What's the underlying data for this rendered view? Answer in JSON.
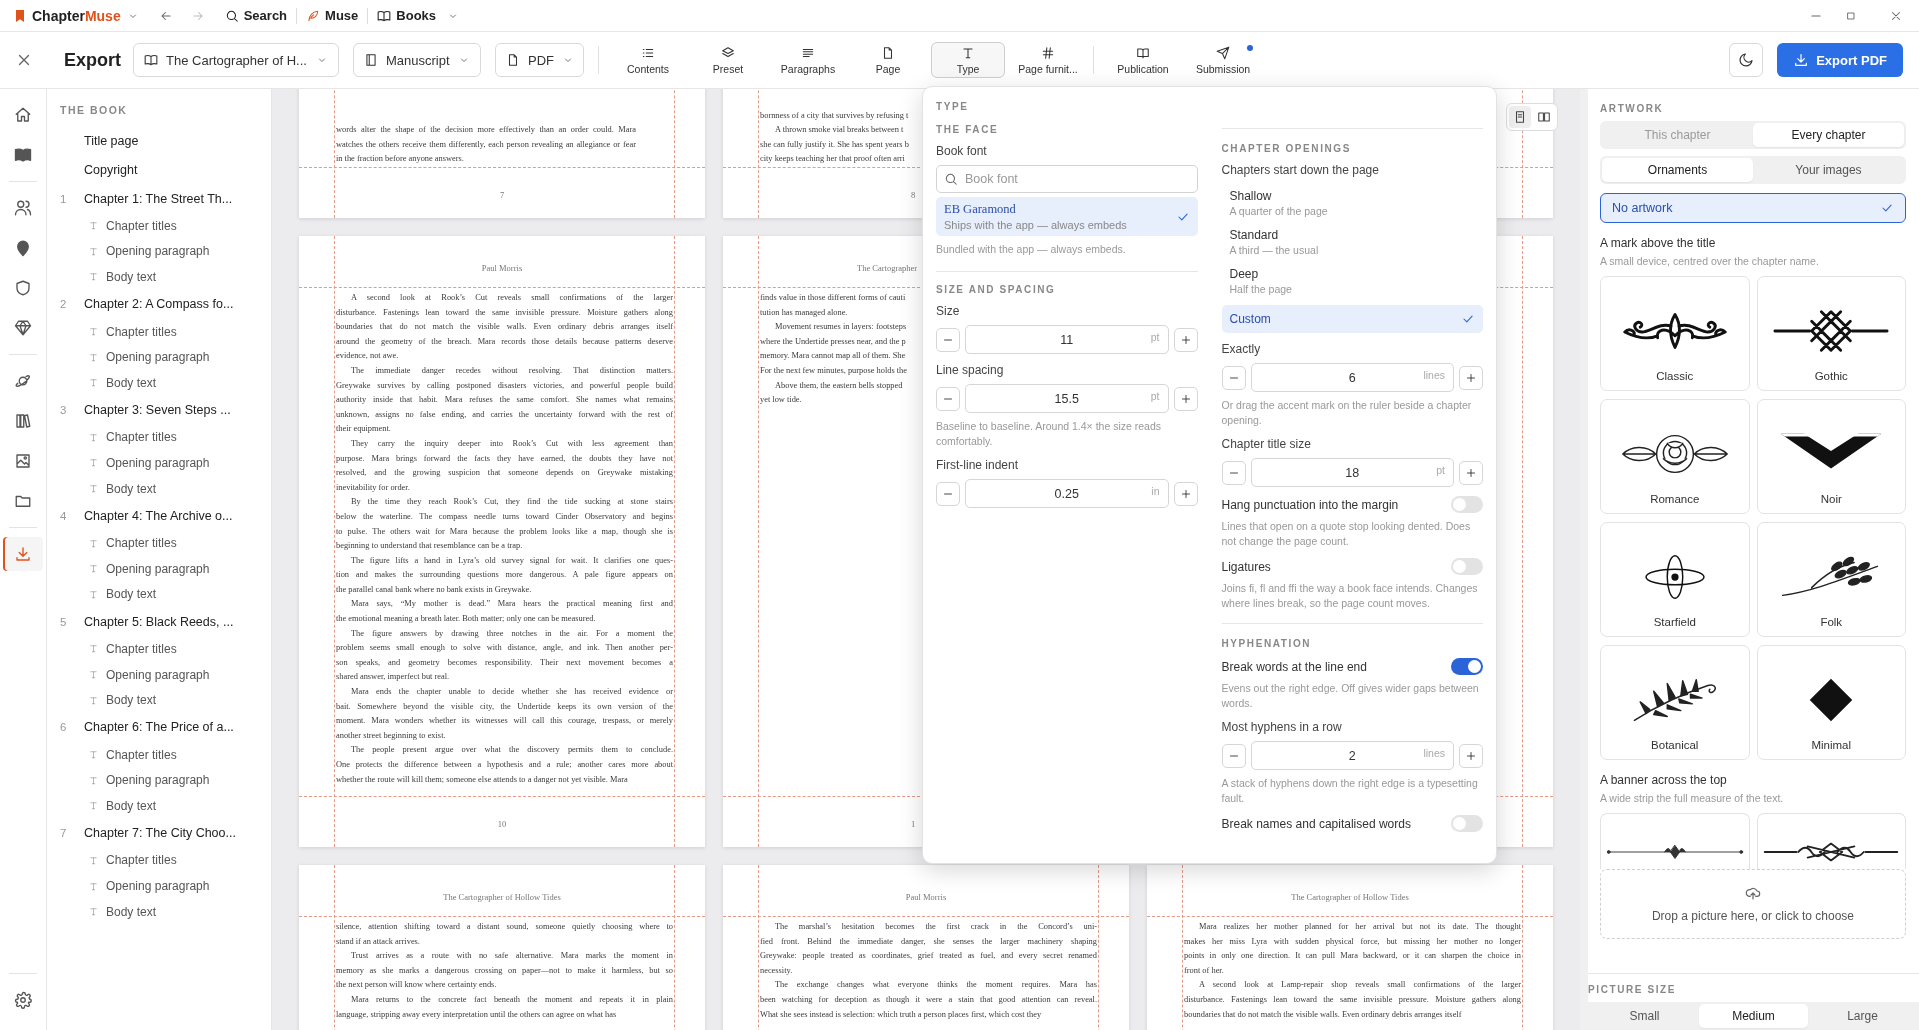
{
  "titlebar": {
    "brand_first": "Chapter",
    "brand_second": "Muse",
    "nav": [
      {
        "kind": "search",
        "label": "Search"
      },
      {
        "kind": "quill",
        "label": "Muse"
      },
      {
        "kind": "book",
        "label": "Books"
      }
    ]
  },
  "toolbar": {
    "title": "Export",
    "dropdowns": [
      {
        "kind": "book",
        "label": "The Cartographer of H..."
      },
      {
        "kind": "manuscript",
        "label": "Manuscript"
      },
      {
        "kind": "file",
        "label": "PDF"
      }
    ],
    "tool_groups": [
      [
        {
          "kind": "list",
          "label": "Contents",
          "selected": false,
          "dot": false
        },
        {
          "kind": "layers",
          "label": "Preset",
          "selected": false,
          "dot": false
        },
        {
          "kind": "paragraphs",
          "label": "Paragraphs",
          "selected": false,
          "dot": false
        },
        {
          "kind": "page",
          "label": "Page",
          "selected": false,
          "dot": false
        },
        {
          "kind": "type",
          "label": "Type",
          "selected": true,
          "dot": false
        },
        {
          "kind": "hash",
          "label": "Page furnit...",
          "selected": false,
          "dot": false
        }
      ],
      [
        {
          "kind": "open-book",
          "label": "Publication",
          "selected": false,
          "dot": false
        },
        {
          "kind": "send",
          "label": "Submission",
          "selected": false,
          "dot": true
        }
      ]
    ],
    "export_label": "Export PDF"
  },
  "rail": [
    [
      {
        "kind": "home",
        "selected": false
      },
      {
        "kind": "book",
        "selected": false
      }
    ],
    [
      {
        "kind": "users",
        "selected": false
      },
      {
        "kind": "map-pin",
        "selected": false
      },
      {
        "kind": "shield",
        "selected": false
      },
      {
        "kind": "gem",
        "selected": false
      }
    ],
    [
      {
        "kind": "planet",
        "selected": false
      },
      {
        "kind": "books",
        "selected": false
      },
      {
        "kind": "image",
        "selected": false
      },
      {
        "kind": "folder",
        "selected": false
      }
    ],
    [
      {
        "kind": "download",
        "selected": true
      }
    ]
  ],
  "sidebar": {
    "heading": "THE BOOK",
    "items": [
      {
        "label": "Title page"
      },
      {
        "label": "Copyright"
      },
      {
        "number": "1",
        "label": "Chapter 1: The Street Th...",
        "children": [
          {
            "label": "Chapter titles"
          },
          {
            "label": "Opening paragraph"
          },
          {
            "label": "Body text"
          }
        ]
      },
      {
        "number": "2",
        "label": "Chapter 2: A Compass fo...",
        "children": [
          {
            "label": "Chapter titles"
          },
          {
            "label": "Opening paragraph"
          },
          {
            "label": "Body text"
          }
        ]
      },
      {
        "number": "3",
        "label": "Chapter 3: Seven Steps ...",
        "children": [
          {
            "label": "Chapter titles"
          },
          {
            "label": "Opening paragraph"
          },
          {
            "label": "Body text"
          }
        ]
      },
      {
        "number": "4",
        "label": "Chapter 4: The Archive o...",
        "children": [
          {
            "label": "Chapter titles"
          },
          {
            "label": "Opening paragraph"
          },
          {
            "label": "Body text"
          }
        ]
      },
      {
        "number": "5",
        "label": "Chapter 5: Black Reeds, ...",
        "children": [
          {
            "label": "Chapter titles"
          },
          {
            "label": "Opening paragraph"
          },
          {
            "label": "Body text"
          }
        ]
      },
      {
        "number": "6",
        "label": "Chapter 6: The Price of a...",
        "children": [
          {
            "label": "Chapter titles"
          },
          {
            "label": "Opening paragraph"
          },
          {
            "label": "Body text"
          }
        ]
      },
      {
        "number": "7",
        "label": "Chapter 7: The City Choo...",
        "children": [
          {
            "label": "Chapter titles"
          },
          {
            "label": "Opening paragraph"
          },
          {
            "label": "Body text"
          }
        ]
      }
    ]
  },
  "view_modes": [
    {
      "kind": "single-page",
      "selected": true
    },
    {
      "kind": "spread",
      "selected": false
    }
  ],
  "pages": [
    {
      "kind": "page",
      "number": "7",
      "paragraphs": [
        {
          "continued": true,
          "lines": [
            "words alter the shape of the decision more effectively than an order could. Mara",
            "watches the others receive them differently, each person revealing an allegiance or fear",
            "in the fraction before anyone answers."
          ]
        }
      ]
    },
    {
      "kind": "page",
      "number": "8",
      "paragraphs": [
        {
          "continued": true,
          "lines": [
            "bornness of a city that survives by refusing t"
          ]
        },
        {
          "continued": false,
          "lines": [
            "A thrown smoke vial breaks between t",
            "she can fully justify it. She has spent years b",
            "city keeps teaching her that proof often arri"
          ]
        }
      ]
    },
    {
      "kind": "page"
    },
    {
      "kind": "page",
      "header": "Paul Morris",
      "number": "10",
      "paragraphs": [
        {
          "continued": false,
          "lines": [
            "A second look at Rook’s Cut reveals small confirmations of the larger",
            "disturbance. Fastenings lean toward the same invisible pressure. Moisture gathers along",
            "boundaries that do not match the visible walls. Even ordinary debris arranges itself",
            "around the geometry of the breach. Mara records those details because patterns deserve",
            "evidence, not awe."
          ]
        },
        {
          "continued": false,
          "lines": [
            "The immediate danger recedes without resolving. That distinction matters.",
            "Greywake survives by calling postponed disasters victories, and powerful people build",
            "authority inside that habit. Mara refuses the same comfort. She names what remains",
            "unknown, assigns no false ending, and carries the uncertainty forward with the rest of",
            "their equipment."
          ]
        },
        {
          "continued": false,
          "lines": [
            "They carry the inquiry deeper into Rook’s Cut with less agreement than",
            "purpose. Mara brings forward the facts they have earned, the doubts they have not",
            "resolved, and the growing suspicion that someone depends on Greywake mistaking",
            "inevitability for order."
          ]
        },
        {
          "continued": false,
          "lines": [
            "By the time they reach Rook’s Cut, they find the tide sucking at stone stairs",
            "below the waterline. The compass needle turns toward Cinder Observatory and begins",
            "to pulse. The others wait for Mara because the problem looks like a map, though she is",
            "beginning to understand that resemblance can be a trap."
          ]
        },
        {
          "continued": false,
          "lines": [
            "The figure lifts a hand in Lyra’s old survey signal for wait. It clarifies one ques-",
            "tion and makes the surrounding questions more dangerous. A pale figure appears on",
            "the parallel canal bank where no bank exists in Greywake."
          ]
        },
        {
          "continued": false,
          "lines": [
            "Mara says, “My mother is dead.” Mara hears the practical meaning first and",
            "the emotional meaning a breath later. Both matter; only one can be measured."
          ]
        },
        {
          "continued": false,
          "lines": [
            "The figure answers by drawing three notches in the air. For a moment the",
            "problem seems small enough to solve with distance, angle, and ink. Then another per-",
            "son speaks, and geometry becomes responsibility. Their next movement becomes a",
            "shared answer, imperfect but real."
          ]
        },
        {
          "continued": false,
          "lines": [
            "Mara ends the chapter unable to decide whether she has received evidence or",
            "bait. Somewhere beyond the visible city, the Undertide keeps its own version of the",
            "moment. Mara wonders whether its witnesses will call this courage, trespass, or merely",
            "another street beginning to exist."
          ]
        },
        {
          "continued": false,
          "lines": [
            "The people present argue over what the discovery permits them to conclude.",
            "One protects the difference between a hypothesis and a rule; another cares more about",
            "whether the route will kill them; someone else attends to a danger not yet visible. Mara"
          ]
        }
      ]
    },
    {
      "kind": "page",
      "header": "The Cartographer",
      "number": "1",
      "paragraphs": [
        {
          "continued": true,
          "lines": [
            "finds value in those different forms of cauti",
            "tution has managed alone."
          ]
        },
        {
          "continued": false,
          "lines": [
            "Movement resumes in layers: footsteps",
            "where the Undertide presses near, and the p",
            "memory. Mara cannot map all of them. She",
            "For the next few minutes, purpose holds the"
          ]
        },
        {
          "continued": false,
          "lines": [
            "Above them, the eastern bells stopped",
            "yet low tide."
          ]
        }
      ]
    },
    {
      "kind": "page"
    },
    {
      "kind": "page",
      "header": "The Cartographer of Hollow Tides",
      "paragraphs": [
        {
          "continued": true,
          "lines": [
            "silence, attention shifting toward a distant sound, someone quietly choosing where to",
            "stand if an attack arrives."
          ]
        },
        {
          "continued": false,
          "lines": [
            "Trust arrives as a route with no safe alternative. Mara marks the moment in",
            "memory as she marks a dangerous crossing on paper—not to make it harmless, but so",
            "the next person will know where certainty ends."
          ]
        },
        {
          "continued": false,
          "lines": [
            "Mara returns to the concrete fact beneath the moment and repeats it in plain",
            "language, stripping away every interpretation until the others can agree on what has"
          ]
        }
      ]
    },
    {
      "kind": "page",
      "header": "Paul Morris",
      "paragraphs": [
        {
          "continued": false,
          "lines": [
            "The marshal’s hesitation becomes the first crack in the Concord’s uni-",
            "fied front. Behind the immediate danger, she senses the larger machinery shaping",
            "Greywake: people treated as coordinates, grief treated as fuel, and every secret renamed",
            "necessity."
          ]
        },
        {
          "continued": false,
          "lines": [
            "The exchange changes what everyone thinks the moment requires. Mara has",
            "been watching for deception as though it were a stain that good attention can reveal.",
            "What she sees instead is selection: which truth a person places first, which cost they"
          ]
        }
      ]
    },
    {
      "kind": "page",
      "header": "The Cartographer of Hollow Tides",
      "paragraphs": [
        {
          "continued": false,
          "lines": [
            "Mara realizes her mother planned for her arrival but not its date. The thought",
            "makes her miss Lyra with sudden physical force, but missing her mother no longer",
            "points in only one direction. It can pull Mara backward, or it can sharpen the choice in",
            "front of her."
          ]
        },
        {
          "continued": false,
          "lines": [
            "A second look at Lamp-repair shop reveals small confirmations of the larger",
            "disturbance. Fastenings lean toward the same invisible pressure. Moisture gathers along",
            "boundaries that do not match the visible walls. Even ordinary debris arranges itself"
          ]
        }
      ]
    }
  ],
  "type_panel": {
    "title": "TYPE",
    "left": [
      {
        "kind": "heading",
        "text": "THE FACE"
      },
      {
        "kind": "font",
        "label": "Book font",
        "placeholder": "Book font",
        "options": [
          {
            "name": "EB Garamond",
            "note": "Ships with the app — always embeds",
            "selected": true
          }
        ],
        "help": "Bundled with the app — always embeds."
      },
      {
        "kind": "rule"
      },
      {
        "kind": "heading",
        "text": "SIZE AND SPACING"
      },
      {
        "kind": "stepper",
        "label": "Size",
        "value": "11",
        "unit": "pt"
      },
      {
        "kind": "stepper",
        "label": "Line spacing",
        "value": "15.5",
        "unit": "pt",
        "help": "Baseline to baseline. Around 1.4× the size reads comfortably."
      },
      {
        "kind": "stepper",
        "label": "First-line indent",
        "value": "0.25",
        "unit": "in"
      }
    ],
    "right": [
      {
        "kind": "rule"
      },
      {
        "kind": "heading",
        "text": "CHAPTER OPENINGS"
      },
      {
        "kind": "choice",
        "label": "Chapters start down the page",
        "options": [
          {
            "name": "Shallow",
            "note": "A quarter of the page",
            "selected": false
          },
          {
            "name": "Standard",
            "note": "A third — the usual",
            "selected": false
          },
          {
            "name": "Deep",
            "note": "Half the page",
            "selected": false
          },
          {
            "name": "Custom",
            "selected": true
          }
        ]
      },
      {
        "kind": "stepper",
        "label": "Exactly",
        "value": "6",
        "unit": "lines",
        "help": "Or drag the accent mark on the ruler beside a chapter opening."
      },
      {
        "kind": "stepper",
        "label": "Chapter title size",
        "value": "18",
        "unit": "pt"
      },
      {
        "kind": "toggle",
        "label": "Hang punctuation into the margin",
        "on": false,
        "help": "Lines that open on a quote stop looking dented. Does not change the page count."
      },
      {
        "kind": "toggle",
        "label": "Ligatures",
        "on": false,
        "help": "Joins fi, fl and ffi the way a book face intends. Changes where lines break, so the page count moves."
      },
      {
        "kind": "rule"
      },
      {
        "kind": "heading",
        "text": "HYPHENATION"
      },
      {
        "kind": "toggle",
        "label": "Break words at the line end",
        "on": true,
        "help": "Evens out the right edge. Off gives wider gaps between words."
      },
      {
        "kind": "stepper",
        "label": "Most hyphens in a row",
        "value": "2",
        "unit": "lines",
        "help": "A stack of hyphens down the right edge is a typesetting fault."
      },
      {
        "kind": "toggle",
        "label": "Break names and capitalised words",
        "on": false
      }
    ]
  },
  "artwork": {
    "title": "ARTWORK",
    "scope": [
      {
        "label": "This chapter",
        "selected": false,
        "disabled": true
      },
      {
        "label": "Every chapter",
        "selected": true,
        "disabled": false
      }
    ],
    "source": [
      {
        "label": "Ornaments",
        "selected": true
      },
      {
        "label": "Your images",
        "selected": false
      }
    ],
    "none_option": {
      "label": "No artwork",
      "selected": true
    },
    "marks": {
      "title": "A mark above the title",
      "help": "A small device, centred over the chapter name.",
      "items": [
        {
          "kind": "flourish",
          "label": "Classic"
        },
        {
          "kind": "knot",
          "label": "Gothic"
        },
        {
          "kind": "rose",
          "label": "Romance"
        },
        {
          "kind": "chevron",
          "label": "Noir"
        },
        {
          "kind": "orbit",
          "label": "Starfield"
        },
        {
          "kind": "wheat",
          "label": "Folk"
        },
        {
          "kind": "fern",
          "label": "Botanical"
        },
        {
          "kind": "diamond",
          "label": "Minimal"
        }
      ]
    },
    "banners": {
      "title": "A banner across the top",
      "help": "A wide strip the full measure of the text.",
      "items": [
        {
          "kind": "scroll-rule"
        },
        {
          "kind": "knot-rule"
        }
      ]
    },
    "drop_label": "Drop a picture here, or click to choose"
  },
  "picture_size": {
    "title": "PICTURE SIZE",
    "options": [
      {
        "label": "Small",
        "selected": false
      },
      {
        "label": "Medium",
        "selected": true
      },
      {
        "label": "Large",
        "selected": false
      }
    ]
  }
}
